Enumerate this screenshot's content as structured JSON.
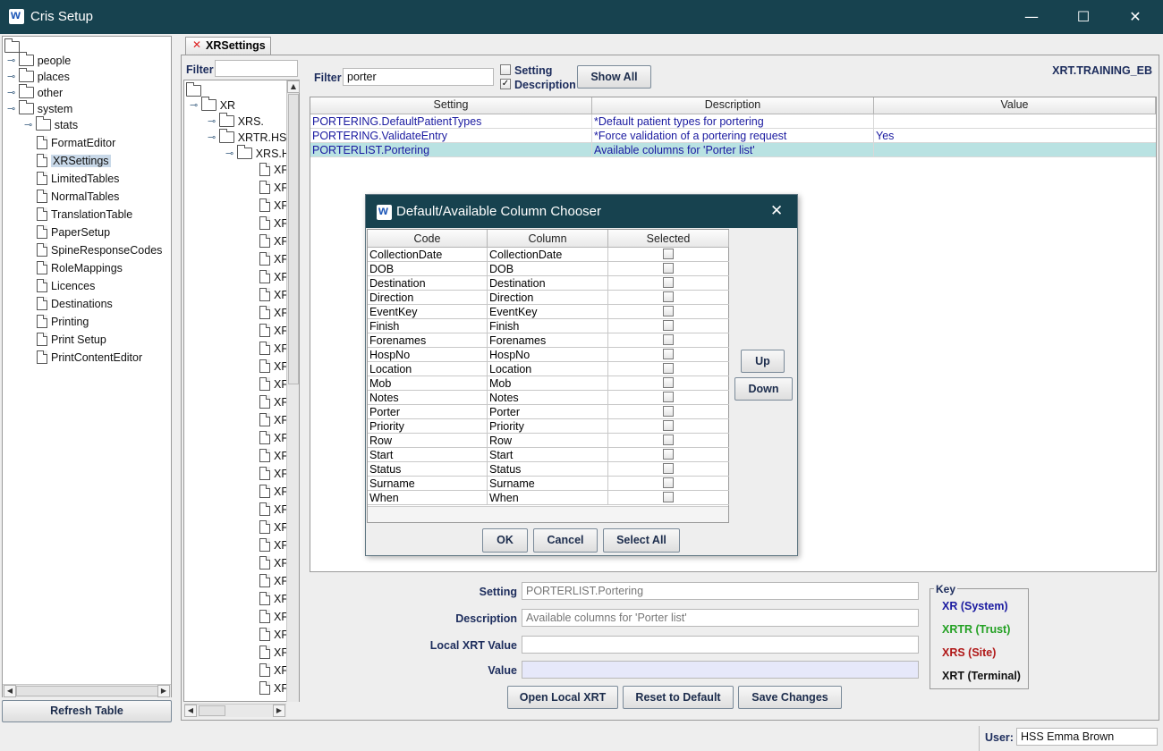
{
  "window": {
    "title": "Cris Setup",
    "minimize": "—",
    "maximize": "☐",
    "close": "✕"
  },
  "left_tree": {
    "top_folders": [
      "people",
      "places",
      "other",
      "system"
    ],
    "system_children": [
      "stats",
      "FormatEditor",
      "XRSettings",
      "LimitedTables",
      "NormalTables",
      "TranslationTable",
      "PaperSetup",
      "SpineResponseCodes",
      "RoleMappings",
      "Licences",
      "Destinations",
      "Printing",
      "Print Setup",
      "PrintContentEditor"
    ],
    "selected": "XRSettings",
    "refresh_label": "Refresh Table"
  },
  "tab": {
    "label": "XRSettings",
    "close_glyph": "✕"
  },
  "middle_tree": {
    "filter_label": "Filter",
    "filter_value": "",
    "nodes": [
      "XR",
      "XRS.",
      "XRTR.HS",
      "XRS.H"
    ],
    "leaf_label": "XF",
    "leaf_count": 30
  },
  "settings_panel": {
    "filter_label": "Filter",
    "filter_value": "porter",
    "setting_check_label": "Setting",
    "description_check_label": "Description",
    "setting_checked": false,
    "description_checked": true,
    "show_all_label": "Show All",
    "context_name": "XRT.TRAINING_EB",
    "columns": [
      "Setting",
      "Description",
      "Value"
    ],
    "rows": [
      {
        "setting": "PORTERING.DefaultPatientTypes",
        "description": "*Default patient types for portering",
        "value": ""
      },
      {
        "setting": "PORTERING.ValidateEntry",
        "description": "*Force validation of a portering request",
        "value": "Yes"
      },
      {
        "setting": "PORTERLIST.Portering",
        "description": "Available columns for 'Porter list'",
        "value": ""
      }
    ],
    "selected_row": 2
  },
  "dialog": {
    "title": "Default/Available Column Chooser",
    "columns": [
      "Code",
      "Column",
      "Selected"
    ],
    "rows": [
      {
        "code": "CollectionDate",
        "column": "CollectionDate",
        "selected": false
      },
      {
        "code": "DOB",
        "column": "DOB",
        "selected": false
      },
      {
        "code": "Destination",
        "column": "Destination",
        "selected": false
      },
      {
        "code": "Direction",
        "column": "Direction",
        "selected": false
      },
      {
        "code": "EventKey",
        "column": "EventKey",
        "selected": false
      },
      {
        "code": "Finish",
        "column": "Finish",
        "selected": false
      },
      {
        "code": "Forenames",
        "column": "Forenames",
        "selected": false
      },
      {
        "code": "HospNo",
        "column": "HospNo",
        "selected": false
      },
      {
        "code": "Location",
        "column": "Location",
        "selected": false
      },
      {
        "code": "Mob",
        "column": "Mob",
        "selected": false
      },
      {
        "code": "Notes",
        "column": "Notes",
        "selected": false
      },
      {
        "code": "Porter",
        "column": "Porter",
        "selected": false
      },
      {
        "code": "Priority",
        "column": "Priority",
        "selected": false
      },
      {
        "code": "Row",
        "column": "Row",
        "selected": false
      },
      {
        "code": "Start",
        "column": "Start",
        "selected": false
      },
      {
        "code": "Status",
        "column": "Status",
        "selected": false
      },
      {
        "code": "Surname",
        "column": "Surname",
        "selected": false
      },
      {
        "code": "When",
        "column": "When",
        "selected": false
      }
    ],
    "up_label": "Up",
    "down_label": "Down",
    "ok_label": "OK",
    "cancel_label": "Cancel",
    "select_all_label": "Select All"
  },
  "detail": {
    "setting_label": "Setting",
    "setting_value": "PORTERLIST.Portering",
    "description_label": "Description",
    "description_value": "Available columns for 'Porter list'",
    "local_xrt_label": "Local XRT Value",
    "local_xrt_value": "",
    "value_label": "Value",
    "value_value": "",
    "open_local_label": "Open Local XRT",
    "reset_label": "Reset to Default",
    "save_label": "Save Changes"
  },
  "key": {
    "title": "Key",
    "items": [
      {
        "label": "XR (System)",
        "color": "#1a1aa0"
      },
      {
        "label": "XRTR (Trust)",
        "color": "#22a022"
      },
      {
        "label": "XRS (Site)",
        "color": "#b01818"
      },
      {
        "label": "XRT (Terminal)",
        "color": "#111111"
      }
    ]
  },
  "status": {
    "user_label": "User:",
    "user_value": "HSS Emma Brown"
  },
  "colors": {
    "titlebar": "#17424f",
    "selection": "#b9e2e2",
    "link_text": "#1a1aa0"
  }
}
